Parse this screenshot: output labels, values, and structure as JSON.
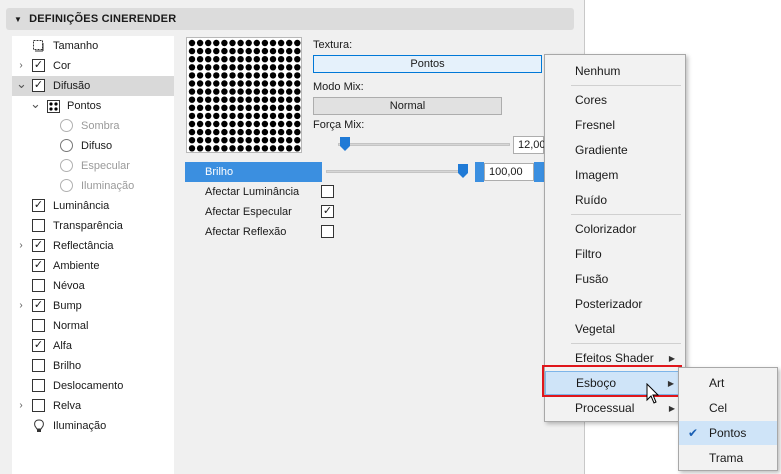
{
  "section": {
    "title": "DEFINIÇÕES CINERENDER"
  },
  "tree": [
    {
      "label": "Tamanho",
      "kind": "icon",
      "icon": "resize-icon",
      "expander": false,
      "checked": false
    },
    {
      "label": "Cor",
      "kind": "checkbox",
      "expander": true,
      "checked": true
    },
    {
      "label": "Difusão",
      "kind": "checkbox",
      "expander": true,
      "expanded": true,
      "checked": true,
      "selected": true
    },
    {
      "label": "Pontos",
      "kind": "icon",
      "icon": "dots-grid-icon",
      "expander": true,
      "expanded": true
    },
    {
      "label": "Sombra",
      "kind": "radio",
      "disabled": true
    },
    {
      "label": "Difuso",
      "kind": "radio",
      "disabled": false
    },
    {
      "label": "Especular",
      "kind": "radio",
      "disabled": true
    },
    {
      "label": "Iluminação",
      "kind": "radio",
      "disabled": true
    },
    {
      "label": "Luminância",
      "kind": "checkbox",
      "expander": false,
      "checked": true
    },
    {
      "label": "Transparência",
      "kind": "checkbox",
      "expander": false,
      "checked": false
    },
    {
      "label": "Reflectância",
      "kind": "checkbox",
      "expander": true,
      "checked": true
    },
    {
      "label": "Ambiente",
      "kind": "checkbox",
      "expander": false,
      "checked": true
    },
    {
      "label": "Névoa",
      "kind": "checkbox",
      "expander": false,
      "checked": false
    },
    {
      "label": "Bump",
      "kind": "checkbox",
      "expander": true,
      "checked": true
    },
    {
      "label": "Normal",
      "kind": "checkbox",
      "expander": false,
      "checked": false
    },
    {
      "label": "Alfa",
      "kind": "checkbox",
      "expander": false,
      "checked": true
    },
    {
      "label": "Brilho",
      "kind": "checkbox",
      "expander": false,
      "checked": false
    },
    {
      "label": "Deslocamento",
      "kind": "checkbox",
      "expander": false,
      "checked": false
    },
    {
      "label": "Relva",
      "kind": "checkbox",
      "expander": true,
      "checked": false
    },
    {
      "label": "Iluminação",
      "kind": "icon",
      "icon": "light-bulb-icon",
      "expander": false
    }
  ],
  "texture": {
    "label": "Textura:",
    "value": "Pontos",
    "mix_mode_label": "Modo Mix:",
    "mix_mode_value": "Normal",
    "mix_strength_label": "Força Mix:",
    "mix_strength_value": "12,00",
    "mix_strength_fraction": 0.12
  },
  "props": {
    "brilho_label": "Brilho",
    "brilho_value": "100,00",
    "brilho_fraction": 1.0,
    "rows": [
      {
        "label": "Afectar Luminância",
        "checked": false
      },
      {
        "label": "Afectar Especular",
        "checked": true
      },
      {
        "label": "Afectar Reflexão",
        "checked": false
      }
    ]
  },
  "menu": {
    "items": [
      {
        "label": "Nenhum",
        "submenu": false
      },
      {
        "label": "Cores",
        "submenu": false
      },
      {
        "label": "Fresnel",
        "submenu": false
      },
      {
        "label": "Gradiente",
        "submenu": false
      },
      {
        "label": "Imagem",
        "submenu": false
      },
      {
        "label": "Ruído",
        "submenu": false
      },
      {
        "label": "Colorizador",
        "submenu": false
      },
      {
        "label": "Filtro",
        "submenu": false
      },
      {
        "label": "Fusão",
        "submenu": false
      },
      {
        "label": "Posterizador",
        "submenu": false
      },
      {
        "label": "Vegetal",
        "submenu": false
      },
      {
        "label": "Efeitos Shader",
        "submenu": true
      },
      {
        "label": "Esboço",
        "submenu": true,
        "highlighted": true
      },
      {
        "label": "Processual",
        "submenu": true
      }
    ]
  },
  "submenu": {
    "items": [
      {
        "label": "Art",
        "checked": false
      },
      {
        "label": "Cel",
        "checked": false
      },
      {
        "label": "Pontos",
        "checked": true
      },
      {
        "label": "Trama",
        "checked": false
      }
    ]
  },
  "colors": {
    "accent": "#3b8fe0",
    "highlight_border": "#e0161b",
    "menu_hover": "#cfe4f8"
  }
}
